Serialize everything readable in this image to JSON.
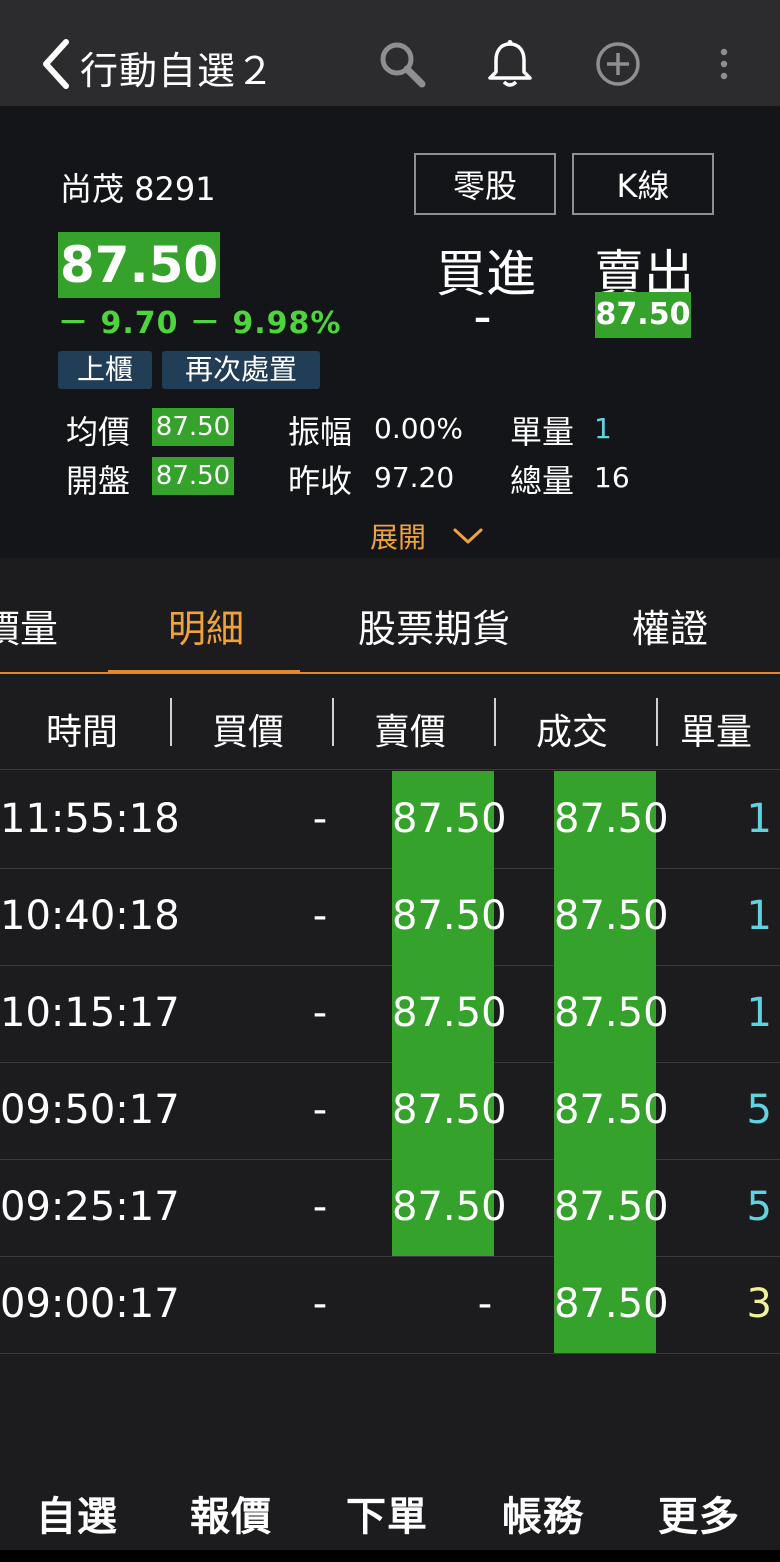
{
  "header": {
    "title": "行動自選２"
  },
  "quote": {
    "stock_name": "尚茂 8291",
    "odd_lot_label": "零股",
    "kline_label": "K線",
    "last_price": "87.50",
    "change": "－ 9.70  － 9.98%",
    "bid_label": "買進",
    "ask_label": "賣出",
    "bid_value": "–",
    "ask_value": "87.50",
    "tags": [
      "上櫃",
      "再次處置"
    ],
    "stats": {
      "avg_label": "均價",
      "avg_value": "87.50",
      "amp_label": "振幅",
      "amp_value": "0.00%",
      "unit_vol_label": "單量",
      "unit_vol_value": "1",
      "open_label": "開盤",
      "open_value": "87.50",
      "prev_close_label": "昨收",
      "prev_close_value": "97.20",
      "total_vol_label": "總量",
      "total_vol_value": "16"
    },
    "expand_label": "展開"
  },
  "tabs": {
    "items": [
      "價量",
      "明細",
      "股票期貨",
      "權證"
    ],
    "active": "明細"
  },
  "table": {
    "headers": [
      "時間",
      "買價",
      "賣價",
      "成交",
      "單量"
    ],
    "rows": [
      {
        "time": "11:55:18",
        "bid": "-",
        "ask": "87.50",
        "trade": "87.50",
        "vol": "1"
      },
      {
        "time": "10:40:18",
        "bid": "-",
        "ask": "87.50",
        "trade": "87.50",
        "vol": "1"
      },
      {
        "time": "10:15:17",
        "bid": "-",
        "ask": "87.50",
        "trade": "87.50",
        "vol": "1"
      },
      {
        "time": "09:50:17",
        "bid": "-",
        "ask": "87.50",
        "trade": "87.50",
        "vol": "5"
      },
      {
        "time": "09:25:17",
        "bid": "-",
        "ask": "87.50",
        "trade": "87.50",
        "vol": "5"
      },
      {
        "time": "09:00:17",
        "bid": "-",
        "ask": "-",
        "trade": "87.50",
        "vol": "3"
      }
    ]
  },
  "bottom_nav": [
    "自選",
    "報價",
    "下單",
    "帳務",
    "更多"
  ],
  "colors": {
    "price_green": "#35a22b",
    "change_green": "#4ed43c",
    "accent_orange": "#f0a23c",
    "vol_cyan": "#5fd4e0",
    "vol_yellow": "#f2f29a"
  }
}
